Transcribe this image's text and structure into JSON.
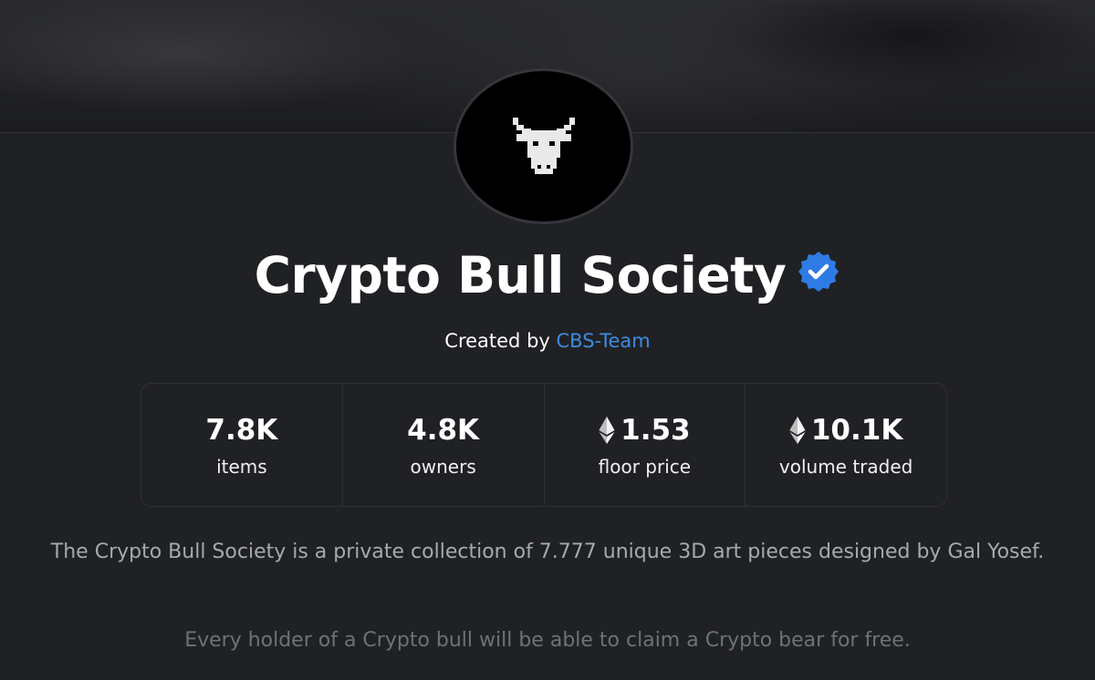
{
  "collection": {
    "title": "Crypto Bull Society",
    "creator_prefix": "Created by",
    "creator_name": "CBS-Team",
    "verified_icon": "verified-badge-icon",
    "avatar_icon": "bull-head-icon"
  },
  "stats": [
    {
      "value": "7.8K",
      "label": "items",
      "currency_icon": null
    },
    {
      "value": "4.8K",
      "label": "owners",
      "currency_icon": null
    },
    {
      "value": "1.53",
      "label": "floor price",
      "currency_icon": "ethereum-icon"
    },
    {
      "value": "10.1K",
      "label": "volume traded",
      "currency_icon": "ethereum-icon"
    }
  ],
  "description": {
    "line1": "The Crypto Bull Society is a private collection of 7.777 unique 3D art pieces designed by Gal Yosef.",
    "line2": "Every holder of a Crypto bull will be able to claim a Crypto bear for free."
  },
  "colors": {
    "background": "#202125",
    "link": "#3e8ae0",
    "verified": "#2f7be5"
  }
}
